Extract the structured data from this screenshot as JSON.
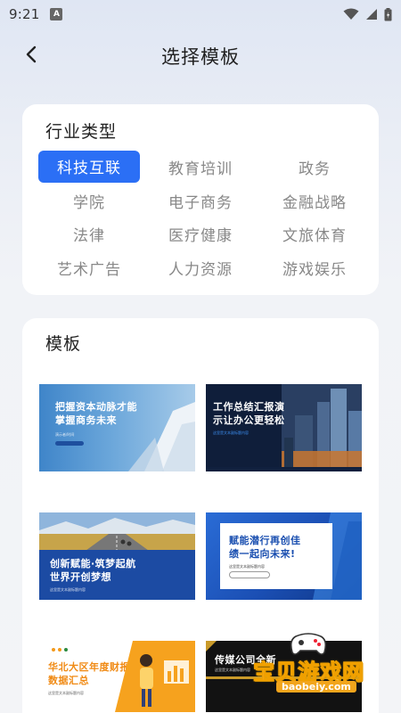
{
  "status_bar": {
    "time": "9:21",
    "notif_icon": "A"
  },
  "nav": {
    "title": "选择模板"
  },
  "industry": {
    "heading": "行业类型",
    "items": [
      {
        "label": "科技互联"
      },
      {
        "label": "教育培训"
      },
      {
        "label": "政务"
      },
      {
        "label": "学院"
      },
      {
        "label": "电子商务"
      },
      {
        "label": "金融战略"
      },
      {
        "label": "法律"
      },
      {
        "label": "医疗健康"
      },
      {
        "label": "文旅体育"
      },
      {
        "label": "艺术广告"
      },
      {
        "label": "人力资源"
      },
      {
        "label": "游戏娱乐"
      }
    ],
    "active_color": "#2b6ff5"
  },
  "templates": {
    "heading": "模板",
    "items": [
      {
        "title_line1": "把握资本动脉才能",
        "title_line2": "掌握商务未来",
        "subtitle": "演示者/时间"
      },
      {
        "title_line1": "工作总结汇报演",
        "title_line2": "示让办公更轻松",
        "subtitle": "这里是文本副标题内容"
      },
      {
        "title_line1": "创新赋能·筑梦起航",
        "title_line2": "世界开创梦想",
        "subtitle": "这里是文本副标题内容"
      },
      {
        "title_line1": "赋能潜行再创佳",
        "title_line2": "绩一起向未来!",
        "subtitle": "这里是文本副标题内容"
      },
      {
        "title_line1": "华北大区年度财报",
        "title_line2": "数据汇总",
        "subtitle": "这里是文本副标题内容"
      },
      {
        "title_line1": "传媒公司全新",
        "title_line2": "",
        "subtitle": "这里是文本副标题内容"
      }
    ]
  },
  "watermark": {
    "text": "宝贝游戏网",
    "url": "baobeiy.com"
  }
}
